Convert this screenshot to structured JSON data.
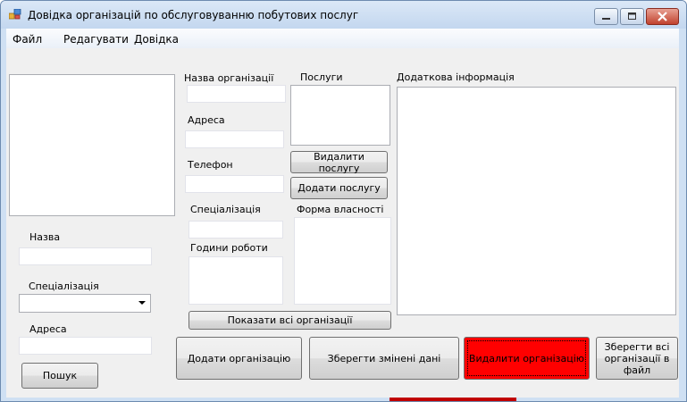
{
  "window": {
    "title": "Довідка організацій по обслуговуванню побутових послуг"
  },
  "menu": {
    "items": [
      {
        "label": "Файл"
      },
      {
        "label": "Редагувати"
      },
      {
        "label": "Довідка"
      }
    ]
  },
  "search": {
    "name_label": "Назва",
    "name_value": "",
    "specialization_label": "Спеціалізація",
    "specialization_value": "",
    "address_label": "Адреса",
    "address_value": "",
    "search_button": "Пошук"
  },
  "details": {
    "org_name_label": "Назва організації",
    "address_label": "Адреса",
    "phone_label": "Телефон",
    "specialization_label": "Спеціалізація",
    "hours_label": "Години роботи",
    "services_label": "Послуги",
    "remove_service_button": "Видалити послугу",
    "add_service_button": "Додати послугу",
    "ownership_label": "Форма власності",
    "extra_info_label": "Додаткова інформація",
    "show_all_button": "Показати всі організації"
  },
  "actions": {
    "add_org": "Додати організацію",
    "save_changes": "Зберегти змінені дані",
    "delete_org": "Видалити організацію",
    "save_to_file": "Зберегти всі організації в файл"
  },
  "colors": {
    "delete_button": "#ff0000",
    "window_frame": "#cfe0f3"
  }
}
